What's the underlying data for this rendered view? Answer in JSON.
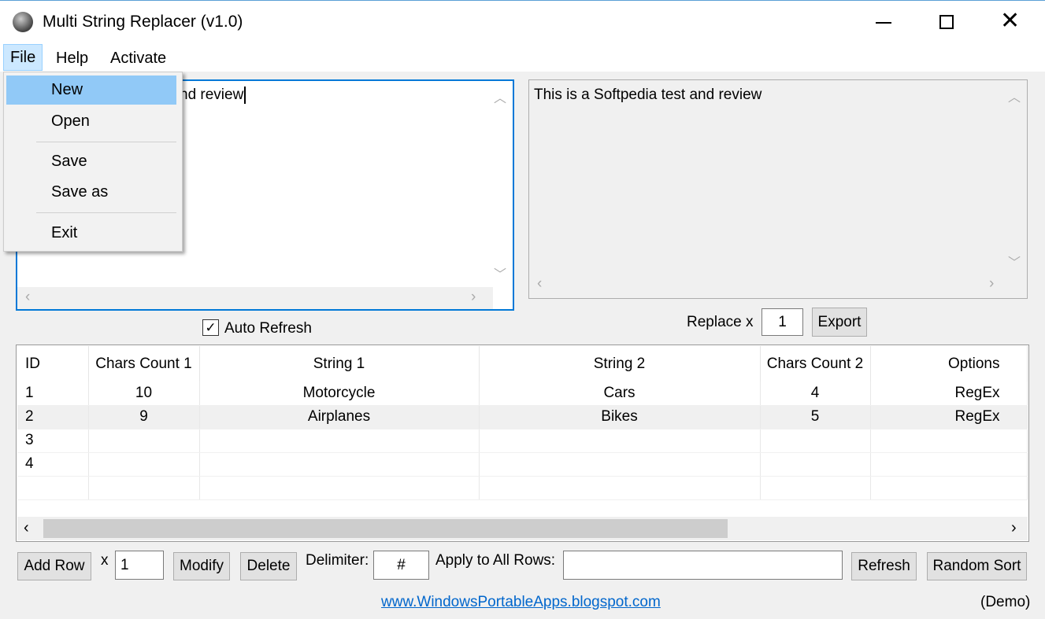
{
  "window": {
    "title": "Multi String Replacer (v1.0)",
    "minimize_icon": "minimize-icon",
    "maximize_icon": "maximize-icon",
    "close_icon": "close-icon"
  },
  "menu": {
    "items": [
      "File",
      "Help",
      "Activate"
    ]
  },
  "file_menu": {
    "items": [
      "New",
      "Open",
      "Save",
      "Save as",
      "Exit"
    ]
  },
  "input_text": "This is a Softpedia test and review",
  "input_visible_text": "nd review",
  "output_text": "This is a Softpedia test and review",
  "auto_refresh": {
    "label": "Auto Refresh",
    "checked": true
  },
  "replace": {
    "label": "Replace x",
    "value": "1",
    "export_label": "Export"
  },
  "table": {
    "columns": [
      "ID",
      "Chars Count 1",
      "String 1",
      "String 2",
      "Chars Count 2",
      "Options"
    ],
    "rows": [
      [
        "1",
        "10",
        "Motorcycle",
        "Cars",
        "4",
        "RegEx"
      ],
      [
        "2",
        "9",
        "Airplanes",
        "Bikes",
        "5",
        "RegEx"
      ],
      [
        "3",
        "",
        "",
        "",
        "",
        ""
      ],
      [
        "4",
        "",
        "",
        "",
        "",
        ""
      ],
      [
        "",
        "",
        "",
        "",
        "",
        ""
      ]
    ],
    "selected_row": 2
  },
  "toolbar": {
    "add_row": "Add Row",
    "x_label": "x",
    "count": "1",
    "modify": "Modify",
    "delete": "Delete",
    "delimiter_label": "Delimiter:",
    "delimiter": "#",
    "apply_label": "Apply to All Rows:",
    "apply_value": "",
    "refresh": "Refresh",
    "random_sort": "Random Sort"
  },
  "footer": {
    "link": "www.WindowsPortableApps.blogspot.com",
    "status": "(Demo)"
  },
  "colors": {
    "accent": "#0078d7",
    "menu_highlight": "#91c9f7",
    "link": "#0066cc"
  }
}
